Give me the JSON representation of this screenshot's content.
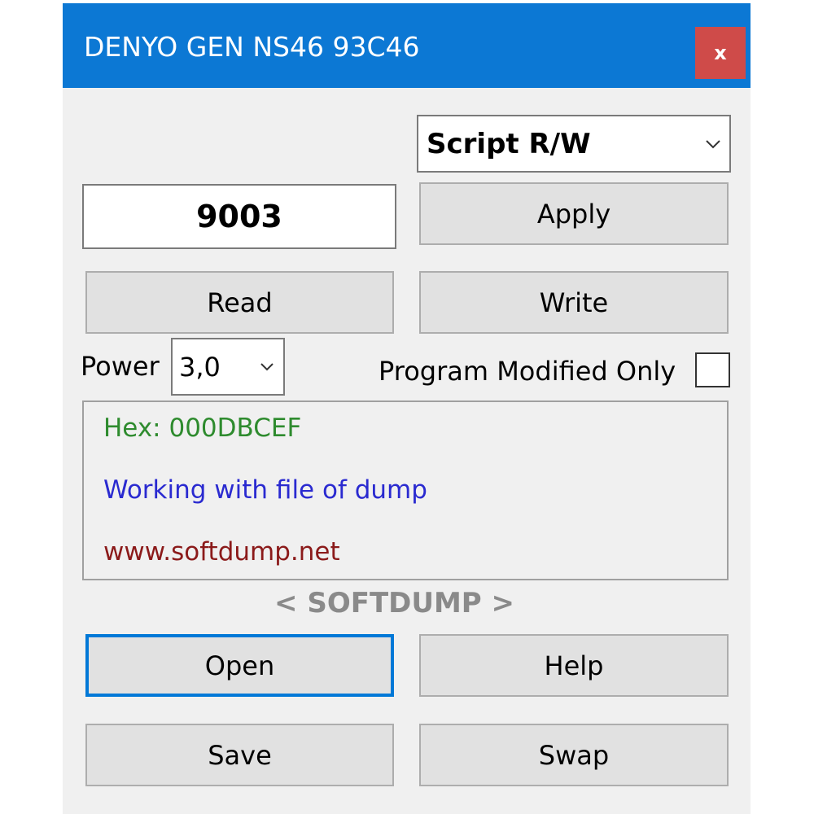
{
  "window": {
    "title": "DENYO GEN NS46 93C46",
    "close_label": "x"
  },
  "mode_select": {
    "value": "Script R/W"
  },
  "code_field": {
    "value": "9003"
  },
  "buttons": {
    "apply": "Apply",
    "read": "Read",
    "write": "Write",
    "open": "Open",
    "help": "Help",
    "save": "Save",
    "swap": "Swap"
  },
  "power": {
    "label": "Power",
    "value": "3,0"
  },
  "program_modified_only": {
    "label": "Program Modified Only",
    "checked": false
  },
  "log": {
    "lines": [
      {
        "text": "Hex: 000DBCEF",
        "color": "#2e8b2e"
      },
      {
        "text": "Working with file of dump",
        "color": "#2a2ad0"
      },
      {
        "text": "www.softdump.net",
        "color": "#8b1a1a"
      }
    ]
  },
  "brand": {
    "text": "< SOFTDUMP >"
  },
  "colors": {
    "titlebar": "#0c78d4",
    "close": "#cf4b49",
    "focus": "#0078d7"
  }
}
